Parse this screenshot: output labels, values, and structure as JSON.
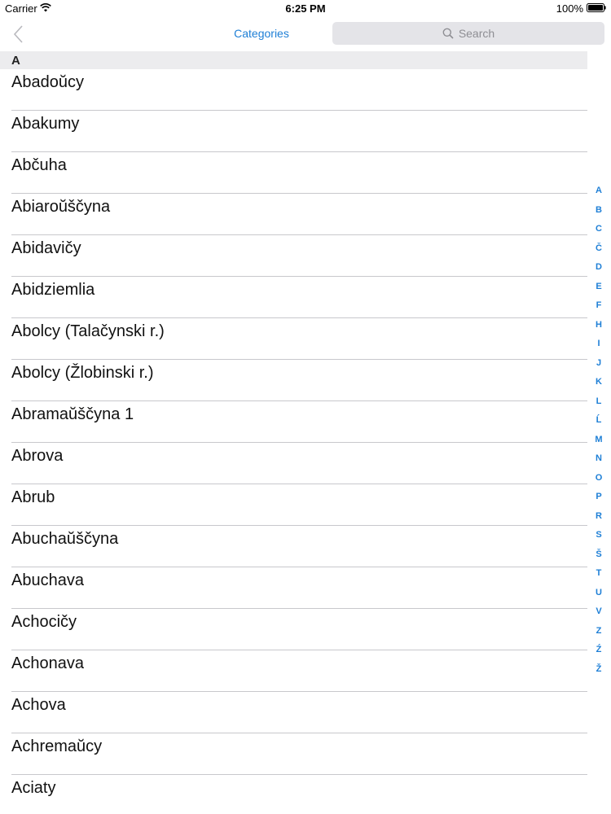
{
  "status_bar": {
    "carrier": "Carrier",
    "time": "6:25 PM",
    "battery": "100%"
  },
  "nav": {
    "title": "Categories",
    "search_placeholder": "Search",
    "accent_color": "#1e7fd6"
  },
  "section": {
    "header": "A"
  },
  "items": [
    "Abadoŭcy",
    "Abakumy",
    "Abčuha",
    "Abiaroŭščyna",
    "Abidavičy",
    "Abidziemlia",
    "Abolcy (Talačynski r.)",
    "Abolcy (Žlobinski r.)",
    "Abramaŭščyna 1",
    "Abrova",
    "Abrub",
    "Abuchaŭščyna",
    "Abuchava",
    "Achocičy",
    "Achonava",
    "Achova",
    "Achremaŭcy",
    "Aciaty"
  ],
  "index": [
    "A",
    "B",
    "C",
    "Č",
    "D",
    "E",
    "F",
    "H",
    "I",
    "J",
    "K",
    "L",
    "Ĺ",
    "M",
    "N",
    "O",
    "P",
    "R",
    "S",
    "Š",
    "T",
    "U",
    "V",
    "Z",
    "Ź",
    "Ž"
  ]
}
